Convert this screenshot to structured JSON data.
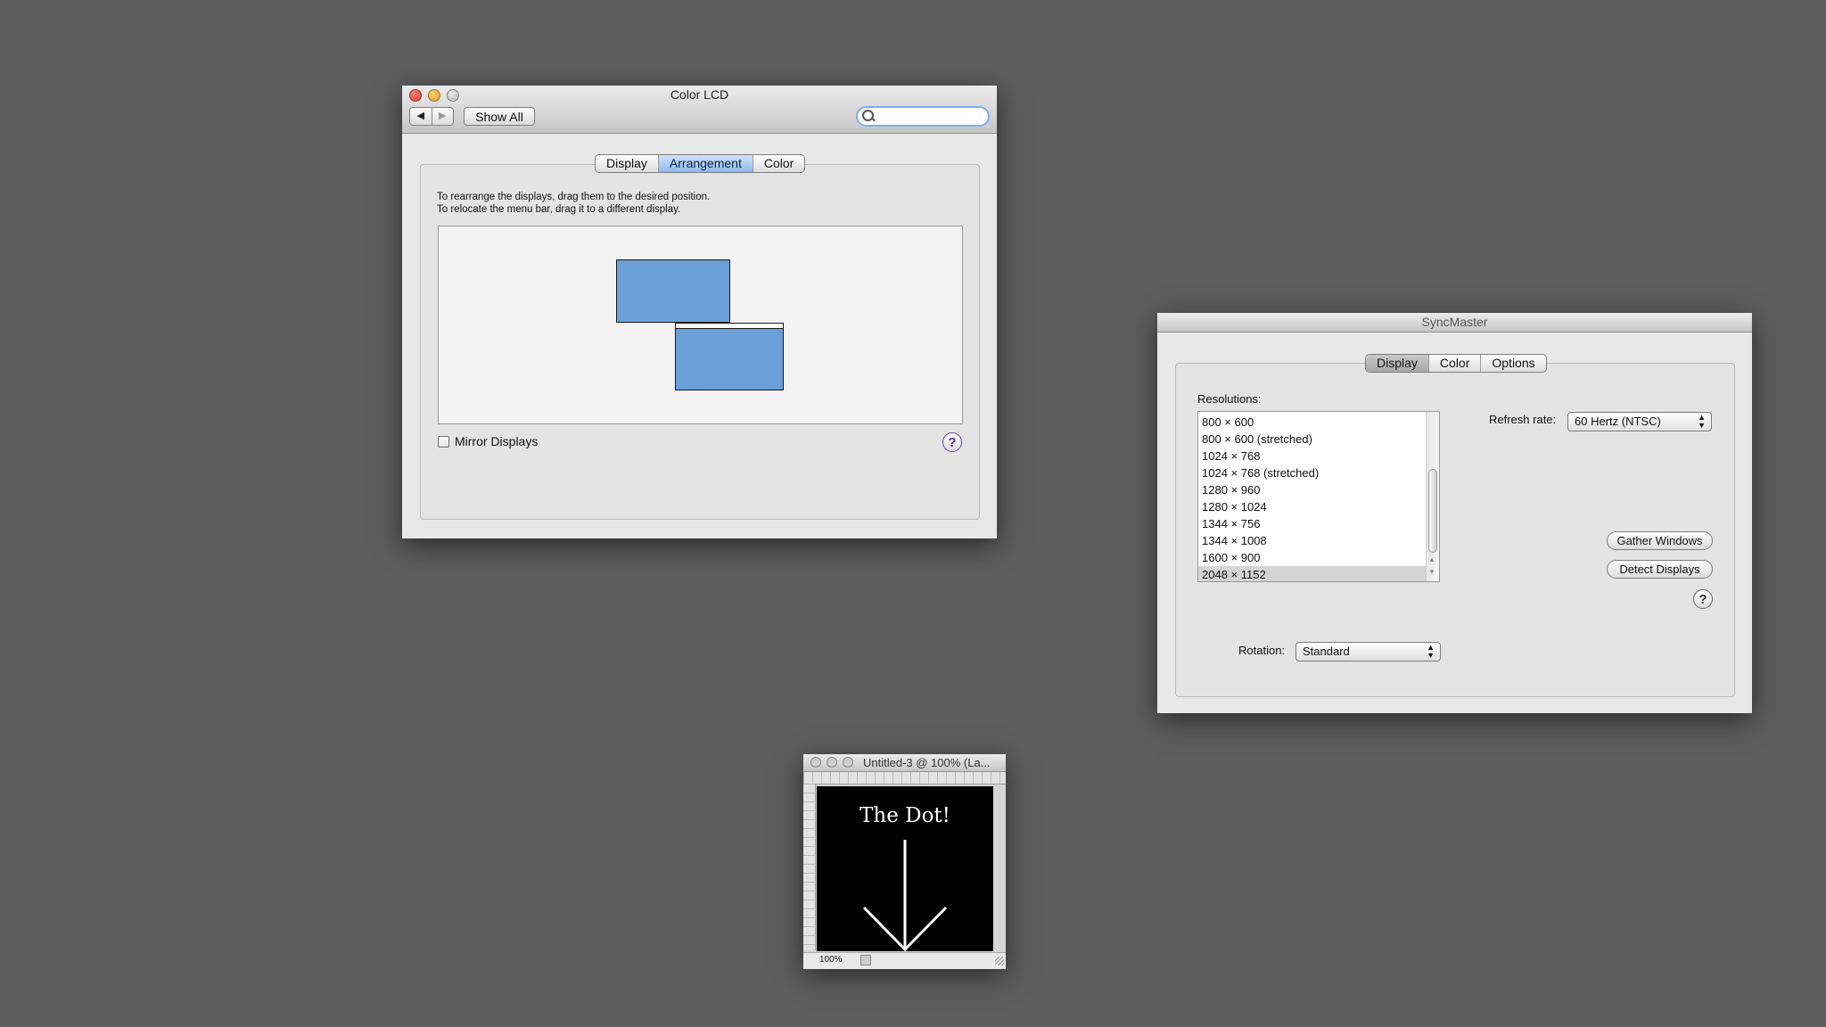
{
  "color_lcd": {
    "title": "Color LCD",
    "show_all": "Show All",
    "search_placeholder": "",
    "tabs": [
      "Display",
      "Arrangement",
      "Color"
    ],
    "instruction_line1": "To rearrange the displays, drag them to the desired position.",
    "instruction_line2": "To relocate the menu bar, drag it to a different display.",
    "mirror_label": "Mirror Displays",
    "help": "?"
  },
  "syncmaster": {
    "title": "SyncMaster",
    "tabs": [
      "Display",
      "Color",
      "Options"
    ],
    "resolutions_label": "Resolutions:",
    "resolutions": [
      "800 × 600",
      "800 × 600 (stretched)",
      "1024 × 768",
      "1024 × 768 (stretched)",
      "1280 × 960",
      "1280 × 1024",
      "1344 × 756",
      "1344 × 1008",
      "1600 × 900",
      "2048 × 1152"
    ],
    "selected_resolution": "2048 × 1152",
    "refresh_label": "Refresh rate:",
    "refresh_value": "60 Hertz (NTSC)",
    "gather_windows": "Gather Windows",
    "detect_displays": "Detect Displays",
    "rotation_label": "Rotation:",
    "rotation_value": "Standard",
    "help": "?"
  },
  "photoshop": {
    "title": "Untitled-3 @ 100% (La...",
    "canvas_text": "The Dot!",
    "zoom": "100%"
  },
  "colors": {
    "display_blue": "#6a9fd8",
    "desktop": "#5d5d5d"
  }
}
